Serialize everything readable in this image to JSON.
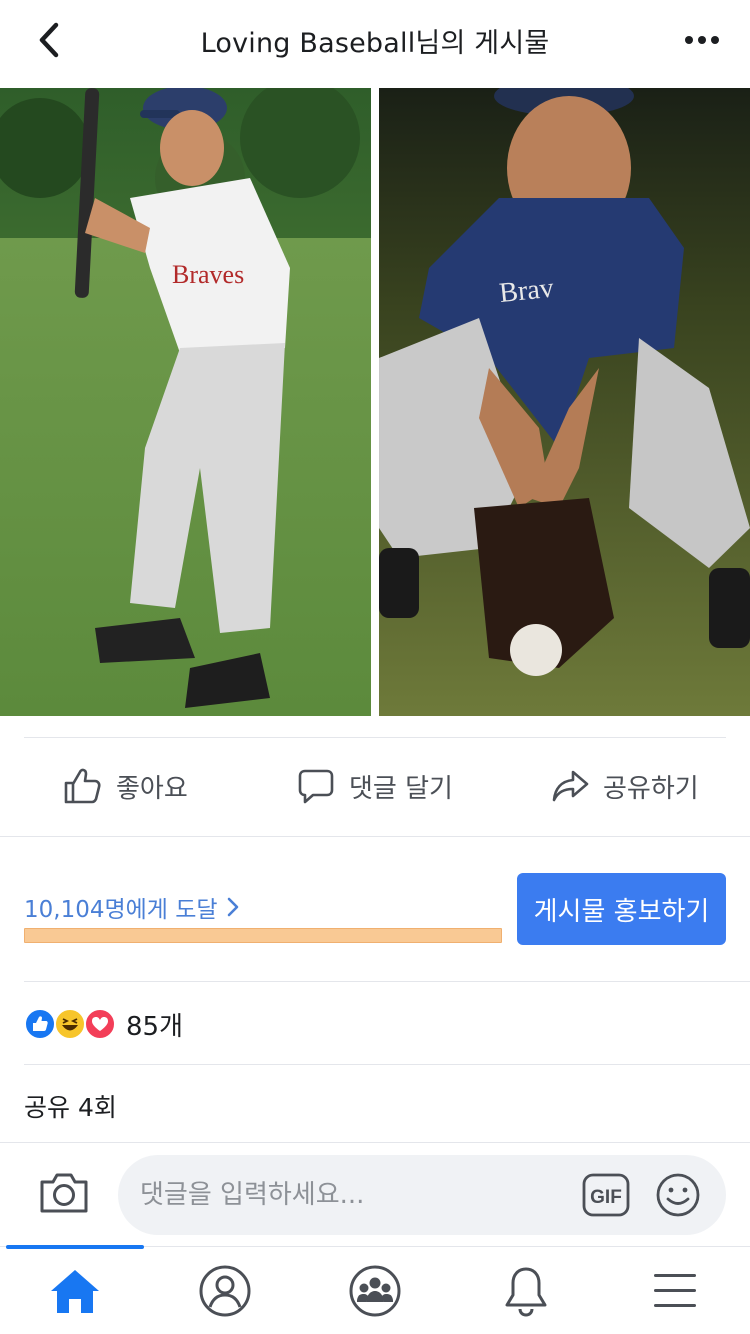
{
  "header": {
    "title": "Loving Baseball님의 게시물",
    "back_icon": "chevron-left-icon",
    "more_icon": "more-horizontal-icon"
  },
  "photos": [
    {
      "name": "batting-photo"
    },
    {
      "name": "fielding-photo"
    }
  ],
  "actions": {
    "like_label": "좋아요",
    "comment_label": "댓글 달기",
    "share_label": "공유하기"
  },
  "insights": {
    "reach_text": "10,104명에게 도달",
    "promote_label": "게시물 홍보하기"
  },
  "reactions": {
    "types": [
      "like-icon",
      "haha-icon",
      "love-icon"
    ],
    "count_text": "85개"
  },
  "shares_text": "공유 4회",
  "composer": {
    "placeholder": "댓글을 입력하세요...",
    "camera_icon": "camera-icon",
    "gif_icon": "gif-icon",
    "emoji_icon": "emoji-icon"
  },
  "tabs": [
    {
      "name": "home-tab",
      "icon": "home-icon",
      "active": true
    },
    {
      "name": "profile-tab",
      "icon": "profile-icon",
      "active": false
    },
    {
      "name": "groups-tab",
      "icon": "groups-icon",
      "active": false
    },
    {
      "name": "notifications-tab",
      "icon": "bell-icon",
      "active": false
    },
    {
      "name": "menu-tab",
      "icon": "menu-icon",
      "active": false
    }
  ],
  "colors": {
    "accent": "#1877f2",
    "promote_button": "#3b7cf0",
    "reach_text": "#4a7fd6",
    "reach_bar": "#f9c994"
  }
}
